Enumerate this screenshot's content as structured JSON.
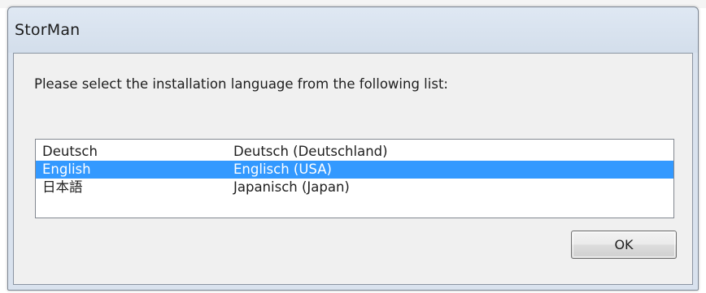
{
  "window": {
    "title": "StorMan"
  },
  "dialog": {
    "prompt": "Please select the installation language from the following list:",
    "languages": [
      {
        "name": "Deutsch",
        "locale": "Deutsch (Deutschland)",
        "selected": false
      },
      {
        "name": "English",
        "locale": "Englisch (USA)",
        "selected": true
      },
      {
        "name": "日本語",
        "locale": "Japanisch (Japan)",
        "selected": false
      }
    ],
    "ok_label": "OK"
  },
  "colors": {
    "selection": "#3399ff",
    "client_background": "#f0f0f0",
    "title_background": "#d9e2ee"
  }
}
